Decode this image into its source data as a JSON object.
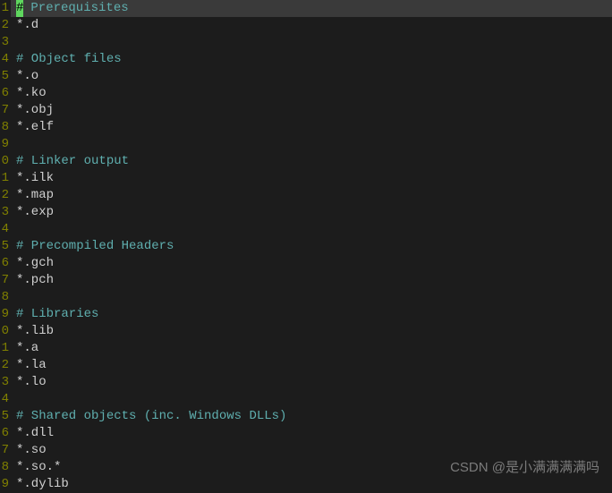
{
  "lines": [
    {
      "num": "1",
      "type": "comment-cursor",
      "text": " Prerequisites",
      "current": true
    },
    {
      "num": "2",
      "type": "text",
      "text": "*.d"
    },
    {
      "num": "3",
      "type": "text",
      "text": ""
    },
    {
      "num": "4",
      "type": "comment",
      "text": "# Object files"
    },
    {
      "num": "5",
      "type": "text",
      "text": "*.o"
    },
    {
      "num": "6",
      "type": "text",
      "text": "*.ko"
    },
    {
      "num": "7",
      "type": "text",
      "text": "*.obj"
    },
    {
      "num": "8",
      "type": "text",
      "text": "*.elf"
    },
    {
      "num": "9",
      "type": "text",
      "text": ""
    },
    {
      "num": "0",
      "type": "comment",
      "text": "# Linker output"
    },
    {
      "num": "1",
      "type": "text",
      "text": "*.ilk"
    },
    {
      "num": "2",
      "type": "text",
      "text": "*.map"
    },
    {
      "num": "3",
      "type": "text",
      "text": "*.exp"
    },
    {
      "num": "4",
      "type": "text",
      "text": ""
    },
    {
      "num": "5",
      "type": "comment",
      "text": "# Precompiled Headers"
    },
    {
      "num": "6",
      "type": "text",
      "text": "*.gch"
    },
    {
      "num": "7",
      "type": "text",
      "text": "*.pch"
    },
    {
      "num": "8",
      "type": "text",
      "text": ""
    },
    {
      "num": "9",
      "type": "comment",
      "text": "# Libraries"
    },
    {
      "num": "0",
      "type": "text",
      "text": "*.lib"
    },
    {
      "num": "1",
      "type": "text",
      "text": "*.a"
    },
    {
      "num": "2",
      "type": "text",
      "text": "*.la"
    },
    {
      "num": "3",
      "type": "text",
      "text": "*.lo"
    },
    {
      "num": "4",
      "type": "text",
      "text": ""
    },
    {
      "num": "5",
      "type": "comment",
      "text": "# Shared objects (inc. Windows DLLs)"
    },
    {
      "num": "6",
      "type": "text",
      "text": "*.dll"
    },
    {
      "num": "7",
      "type": "text",
      "text": "*.so"
    },
    {
      "num": "8",
      "type": "text",
      "text": "*.so.*"
    },
    {
      "num": "9",
      "type": "text",
      "text": "*.dylib"
    }
  ],
  "cursor_char": "#",
  "watermark": "CSDN @是小满满满满吗"
}
